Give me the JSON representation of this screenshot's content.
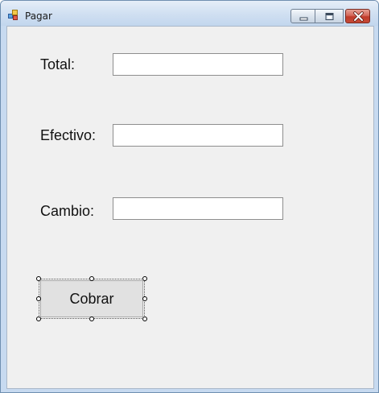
{
  "window": {
    "title": "Pagar"
  },
  "form": {
    "fields": [
      {
        "label": "Total:",
        "value": ""
      },
      {
        "label": "Efectivo:",
        "value": ""
      },
      {
        "label": "Cambio:",
        "value": ""
      }
    ],
    "button_label": "Cobrar"
  },
  "icons": {
    "app": "app-form-icon",
    "minimize": "minimize-icon",
    "maximize": "maximize-icon",
    "close": "close-icon"
  },
  "colors": {
    "client_background": "#f0f0f0",
    "close_button": "#c64a36",
    "titlebar": "#cfdff1"
  }
}
